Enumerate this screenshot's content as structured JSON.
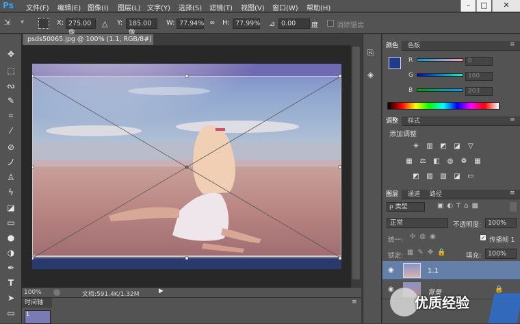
{
  "app": {
    "logo": "Ps"
  },
  "menu": [
    "文件(F)",
    "编辑(E)",
    "图像(I)",
    "图层(L)",
    "文字(Y)",
    "选择(S)",
    "滤镜(T)",
    "视图(V)",
    "窗口(W)",
    "帮助(H)"
  ],
  "window_buttons": [
    "–",
    "□",
    "✕"
  ],
  "options": {
    "x_label": "X:",
    "x_value": "275.00 像",
    "y_label": "Y:",
    "y_value": "185.00 像",
    "w_label": "W:",
    "w_value": "77.94%",
    "h_label": "H:",
    "h_value": "77.99%",
    "angle_value": "0.00",
    "angle_unit": "度",
    "antialias_label": "消除锯齿"
  },
  "document": {
    "tab_title": "psds50065.jpg @ 100% (1.1, RGB/8#)",
    "close": "×",
    "zoom": "100%",
    "doc_info": "文档:591.4K/1.32M"
  },
  "timeline": {
    "tab_label": "时间轴",
    "frame_number": "1"
  },
  "color_panel": {
    "tabs": [
      "颜色",
      "色板"
    ],
    "r_label": "R",
    "r_value": "0",
    "g_label": "G",
    "g_value": "160",
    "b_label": "B",
    "b_value": "203",
    "fg_color": "#1f3a8f",
    "bg_color": "#1fa0cb"
  },
  "adjust_panel": {
    "tabs": [
      "调整",
      "样式"
    ],
    "title": "添加调整"
  },
  "layers_panel": {
    "tabs": [
      "图层",
      "通道",
      "路径"
    ],
    "filter_label": "ρ 类型",
    "blend_mode": "正常",
    "opacity_label": "不透明度:",
    "opacity_value": "100%",
    "unify_label": "统一:",
    "propagate_label": "传播帧 1",
    "lock_label": "锁定:",
    "fill_label": "填充:",
    "fill_value": "100%",
    "layers": [
      {
        "name": "1.1",
        "selected": true
      },
      {
        "name": "背景",
        "selected": false
      }
    ]
  },
  "watermark": {
    "text": "优质经验"
  }
}
